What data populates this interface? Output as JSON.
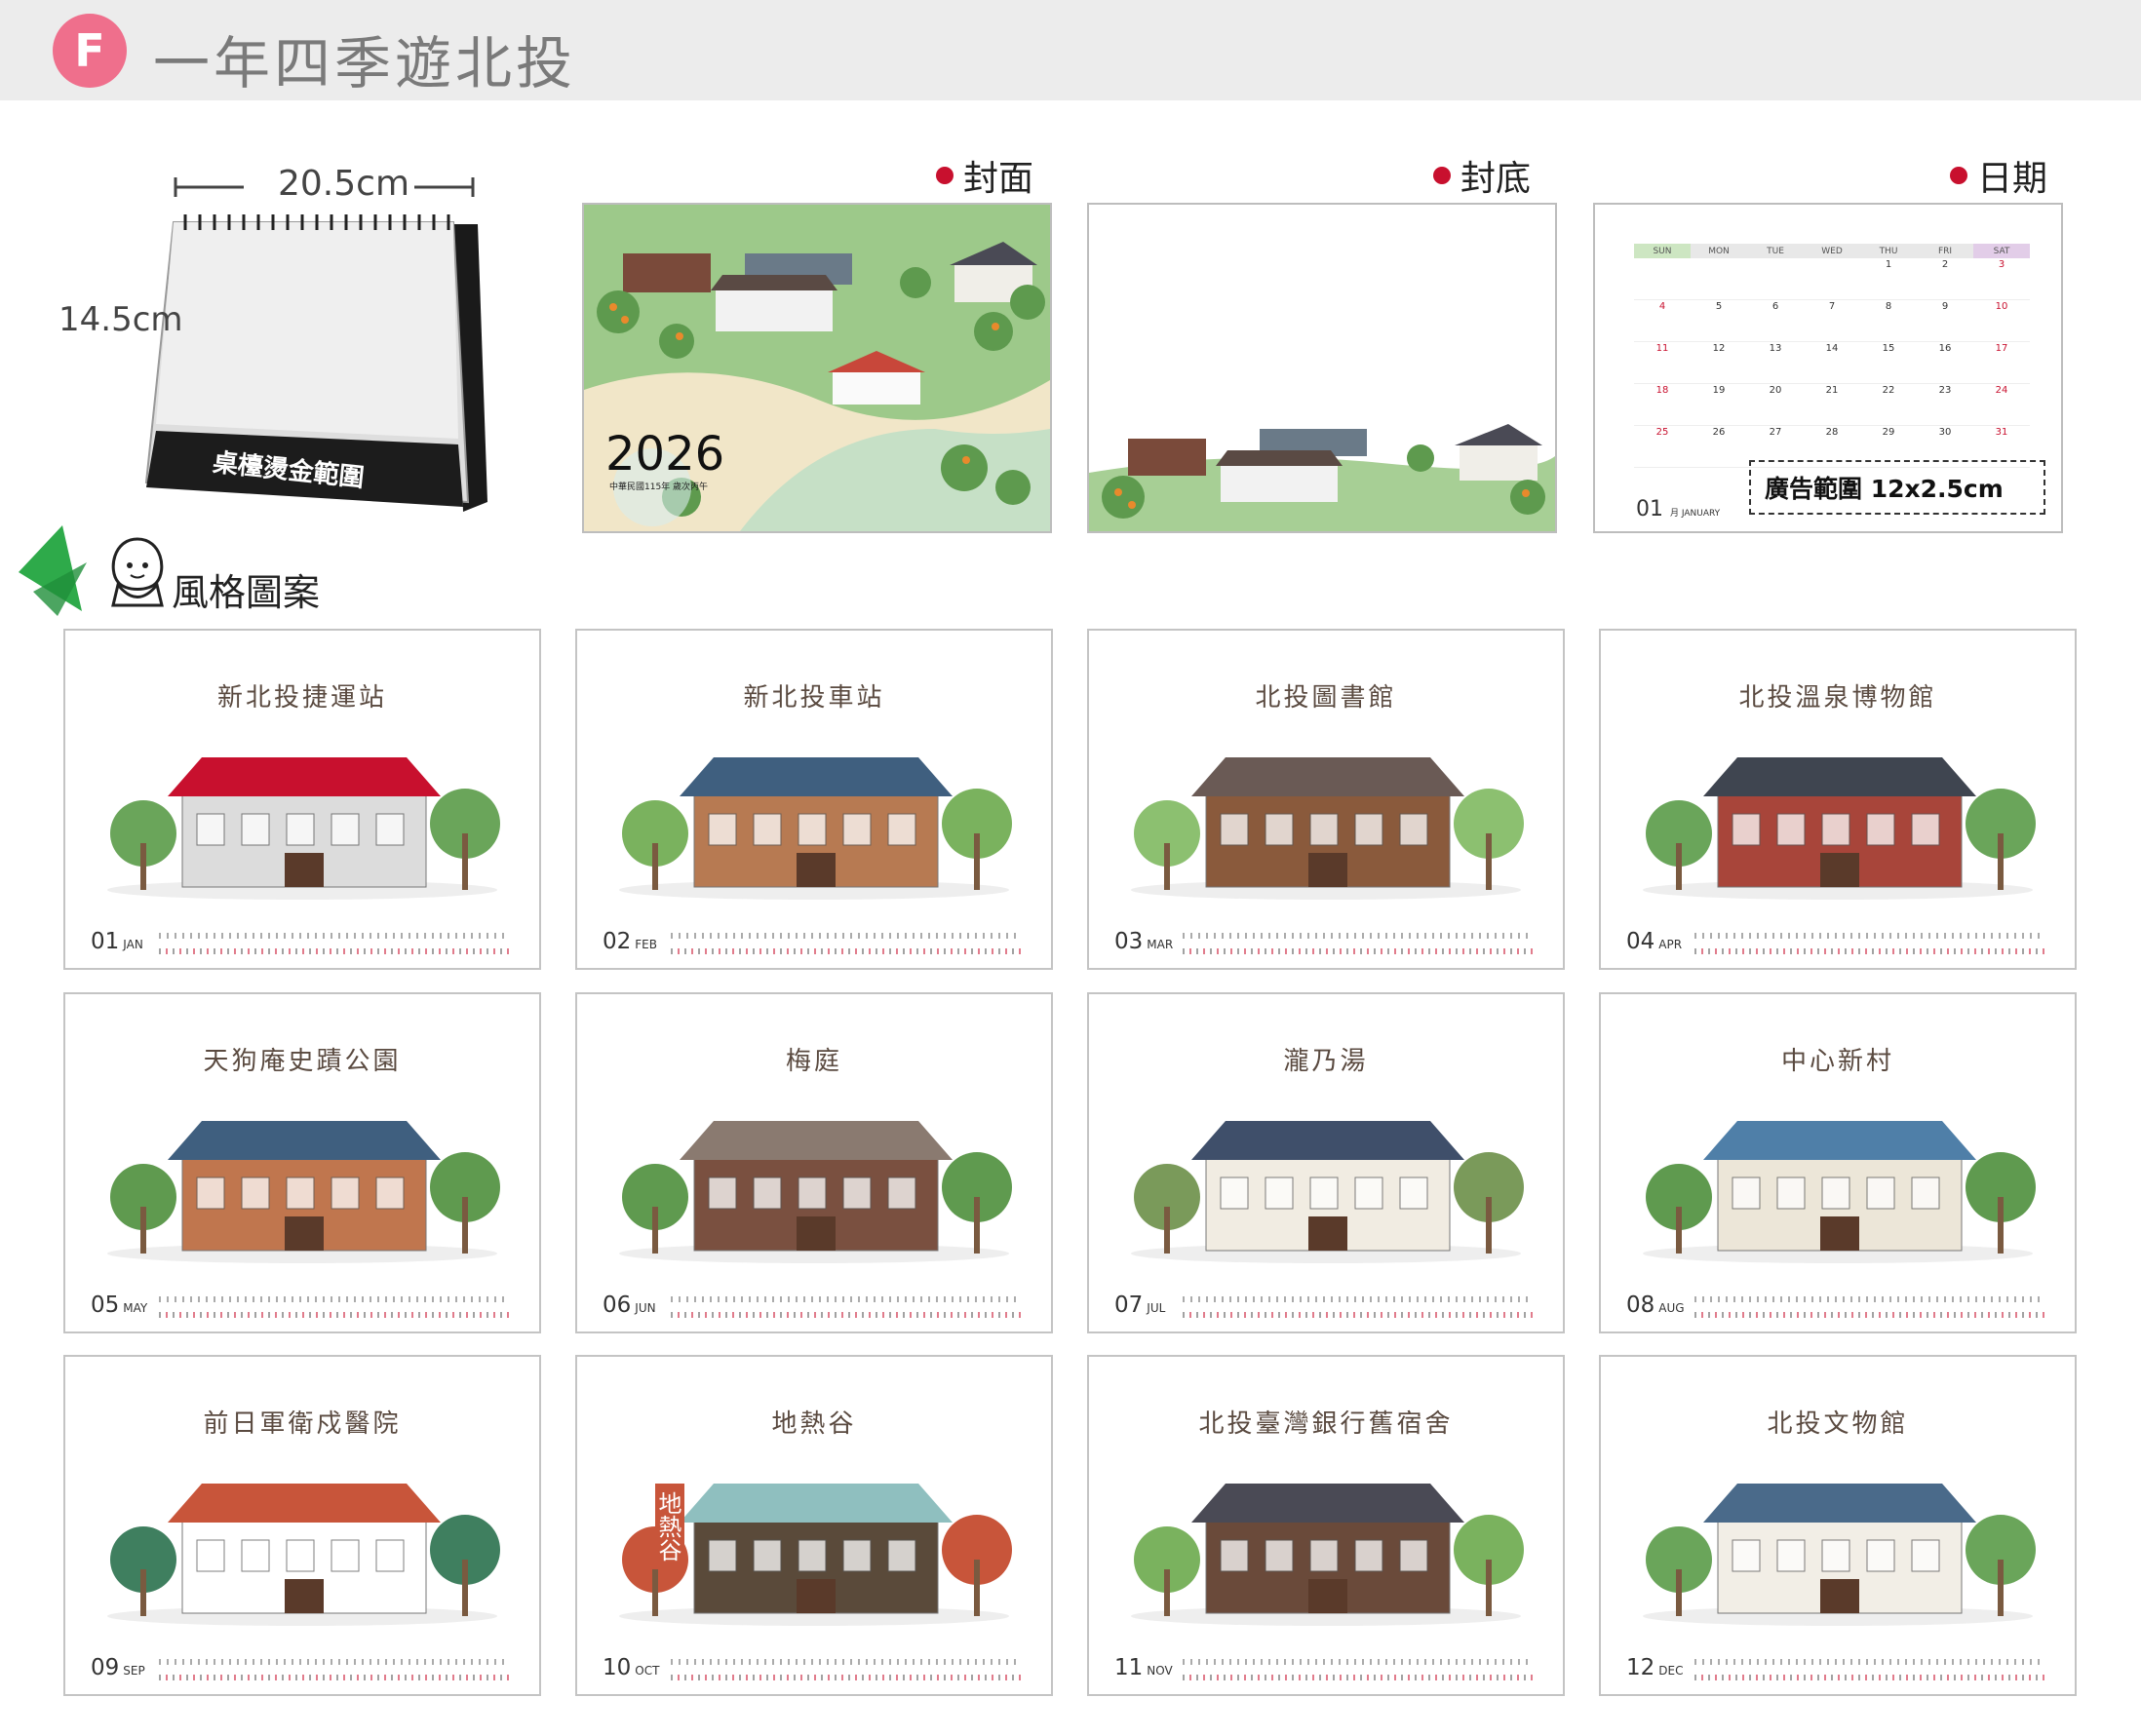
{
  "header": {
    "badge": "F",
    "title": "一年四季遊北投"
  },
  "product": {
    "width_label": "20.5cm",
    "height_label": "14.5cm",
    "base_label": "桌檯燙金範圍"
  },
  "sections": {
    "cover": "封面",
    "back": "封底",
    "date": "日期",
    "style": "風格圖案"
  },
  "cover": {
    "year": "2026",
    "subtitle": "中華民國115年 歲次丙午"
  },
  "date_page": {
    "weekdays": [
      "SUN",
      "MON",
      "TUE",
      "WED",
      "THU",
      "FRI",
      "SAT"
    ],
    "month_num": "01",
    "month_label": "月 JANUARY",
    "ad_label": "廣告範圍 12x2.5cm",
    "rows": [
      [
        "",
        "",
        "",
        "",
        "1",
        "2",
        "3"
      ],
      [
        "4",
        "5",
        "6",
        "7",
        "8",
        "9",
        "10"
      ],
      [
        "11",
        "12",
        "13",
        "14",
        "15",
        "16",
        "17"
      ],
      [
        "18",
        "19",
        "20",
        "21",
        "22",
        "23",
        "24"
      ],
      [
        "25",
        "26",
        "27",
        "28",
        "29",
        "30",
        "31"
      ]
    ]
  },
  "months": [
    {
      "num": "01",
      "abbr": "JAN",
      "title": "新北投捷運站",
      "scene": "gate"
    },
    {
      "num": "02",
      "abbr": "FEB",
      "title": "新北投車站",
      "scene": "station"
    },
    {
      "num": "03",
      "abbr": "MAR",
      "title": "北投圖書館",
      "scene": "library"
    },
    {
      "num": "04",
      "abbr": "APR",
      "title": "北投溫泉博物館",
      "scene": "museum"
    },
    {
      "num": "05",
      "abbr": "MAY",
      "title": "天狗庵史蹟公園",
      "scene": "park"
    },
    {
      "num": "06",
      "abbr": "JUN",
      "title": "梅庭",
      "scene": "meiting"
    },
    {
      "num": "07",
      "abbr": "JUL",
      "title": "瀧乃湯",
      "scene": "bath"
    },
    {
      "num": "08",
      "abbr": "AUG",
      "title": "中心新村",
      "scene": "village"
    },
    {
      "num": "09",
      "abbr": "SEP",
      "title": "前日軍衛戍醫院",
      "scene": "hospital"
    },
    {
      "num": "10",
      "abbr": "OCT",
      "title": "地熱谷",
      "scene": "valley"
    },
    {
      "num": "11",
      "abbr": "NOV",
      "title": "北投臺灣銀行舊宿舍",
      "scene": "dorm"
    },
    {
      "num": "12",
      "abbr": "DEC",
      "title": "北投文物館",
      "scene": "culture"
    }
  ],
  "valley_sign": "地熱谷",
  "colors": {
    "accent_red": "#c8102e",
    "badge_pink": "#ef6f8c",
    "grass": "#8fbf7a",
    "tree": "#6aa55a",
    "roof_blue": "#3f5f7f",
    "wood": "#8a5a3c"
  }
}
